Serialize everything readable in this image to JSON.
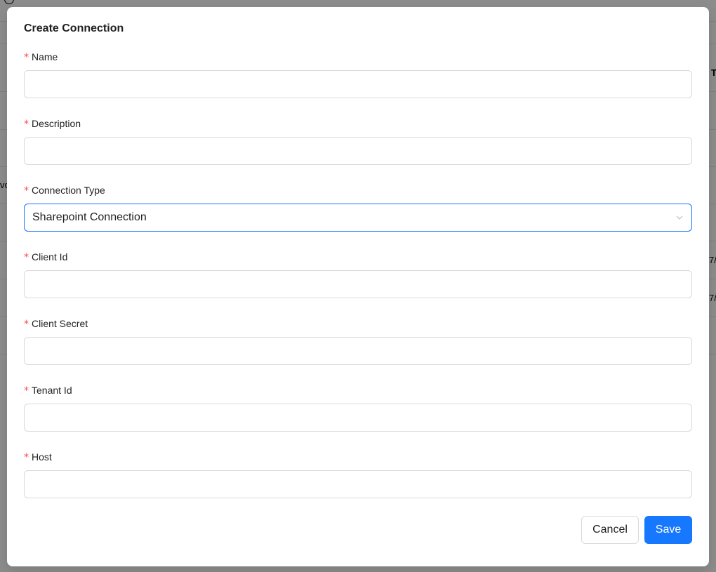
{
  "background": {
    "fragments": [
      "vo",
      "T",
      "7/",
      "7/"
    ]
  },
  "modal": {
    "title": "Create Connection",
    "required_mark": "*",
    "fields": {
      "name": {
        "label": "Name",
        "value": ""
      },
      "description": {
        "label": "Description",
        "value": ""
      },
      "connection_type": {
        "label": "Connection Type",
        "value": "Sharepoint Connection"
      },
      "client_id": {
        "label": "Client Id",
        "value": ""
      },
      "client_secret": {
        "label": "Client Secret",
        "value": ""
      },
      "tenant_id": {
        "label": "Tenant Id",
        "value": ""
      },
      "host": {
        "label": "Host",
        "value": ""
      }
    },
    "buttons": {
      "cancel": "Cancel",
      "save": "Save"
    }
  },
  "colors": {
    "primary": "#1677ff",
    "required": "#ff4d4f",
    "border": "#d9d9d9"
  }
}
